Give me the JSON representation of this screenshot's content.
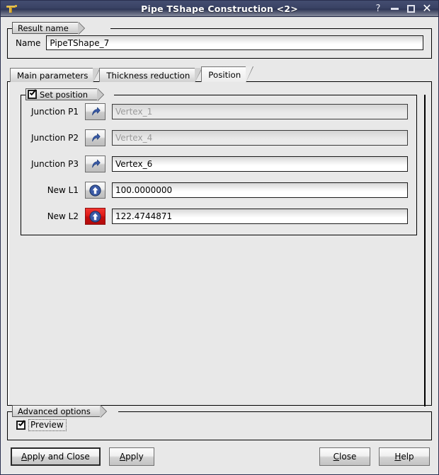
{
  "window": {
    "title": "Pipe TShape Construction <2>",
    "icon": "wrench-icon",
    "controls": {
      "help": "?",
      "minimize": "minimize-icon",
      "maximize": "maximize-icon",
      "close": "close-icon"
    }
  },
  "result_name": {
    "group_title": "Result name",
    "name_label": "Name",
    "name_value": "PipeTShape_7"
  },
  "tabs": [
    {
      "label": "Main parameters",
      "active": false
    },
    {
      "label": "Thickness reduction",
      "active": false
    },
    {
      "label": "Position",
      "active": true
    }
  ],
  "position": {
    "group_title": "Set position",
    "checked": true,
    "rows": [
      {
        "label": "Junction P1",
        "button_icon": "select-arrow-icon",
        "button_state": "normal",
        "value": "Vertex_1",
        "disabled": true
      },
      {
        "label": "Junction P2",
        "button_icon": "select-arrow-icon",
        "button_state": "normal",
        "value": "Vertex_4",
        "disabled": true
      },
      {
        "label": "Junction P3",
        "button_icon": "select-arrow-icon",
        "button_state": "normal",
        "value": "Vertex_6",
        "disabled": false
      },
      {
        "label": "New L1",
        "button_icon": "variable-circle-icon",
        "button_state": "normal",
        "value": "100.0000000",
        "disabled": false
      },
      {
        "label": "New L2",
        "button_icon": "variable-circle-icon",
        "button_state": "danger",
        "value": "122.4744871",
        "disabled": false
      }
    ]
  },
  "advanced": {
    "group_title": "Advanced options",
    "preview_label": "Preview",
    "preview_checked": true
  },
  "buttons": {
    "apply_and_close": {
      "pre": "",
      "mnemonic": "A",
      "post": "pply and Close"
    },
    "apply": {
      "pre": "",
      "mnemonic": "A",
      "post": "pply"
    },
    "close": {
      "pre": "",
      "mnemonic": "C",
      "post": "lose"
    },
    "help": {
      "pre": "",
      "mnemonic": "H",
      "post": "elp"
    }
  },
  "colors": {
    "titlebar": "#3a4365",
    "danger": "#d81515",
    "icon_blue": "#3b5aa6",
    "face": "#e8e8e8"
  }
}
